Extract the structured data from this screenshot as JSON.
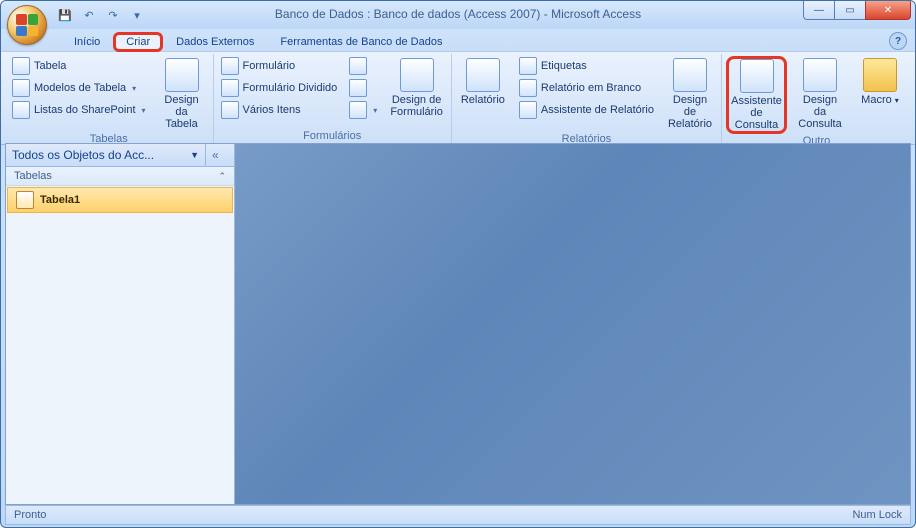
{
  "title": "Banco de Dados : Banco de dados (Access 2007) - Microsoft Access",
  "qat": {
    "save": "save-icon",
    "undo": "undo-icon",
    "redo": "redo-icon"
  },
  "tabs": {
    "inicio": "Início",
    "criar": "Criar",
    "dados_externos": "Dados Externos",
    "ferramentas": "Ferramentas de Banco de Dados"
  },
  "ribbon": {
    "tabelas": {
      "label": "Tabelas",
      "tabela": "Tabela",
      "modelos": "Modelos de Tabela",
      "sharepoint": "Listas do SharePoint",
      "design": "Design da Tabela"
    },
    "formularios": {
      "label": "Formulários",
      "formulario": "Formulário",
      "dividido": "Formulário Dividido",
      "varios": "Vários Itens",
      "more": "more-forms-icon",
      "design": "Design de Formulário"
    },
    "relatorios": {
      "label": "Relatórios",
      "relatorio": "Relatório",
      "etiquetas": "Etiquetas",
      "branco": "Relatório em Branco",
      "assistente": "Assistente de Relatório",
      "design": "Design de Relatório"
    },
    "outro": {
      "label": "Outro",
      "assistente_consulta": "Assistente de Consulta",
      "design_consulta": "Design da Consulta",
      "macro": "Macro"
    }
  },
  "nav": {
    "header": "Todos os Objetos do Acc...",
    "tables_label": "Tabelas",
    "item1": "Tabela1"
  },
  "status": {
    "left": "Pronto",
    "right": "Num Lock"
  }
}
